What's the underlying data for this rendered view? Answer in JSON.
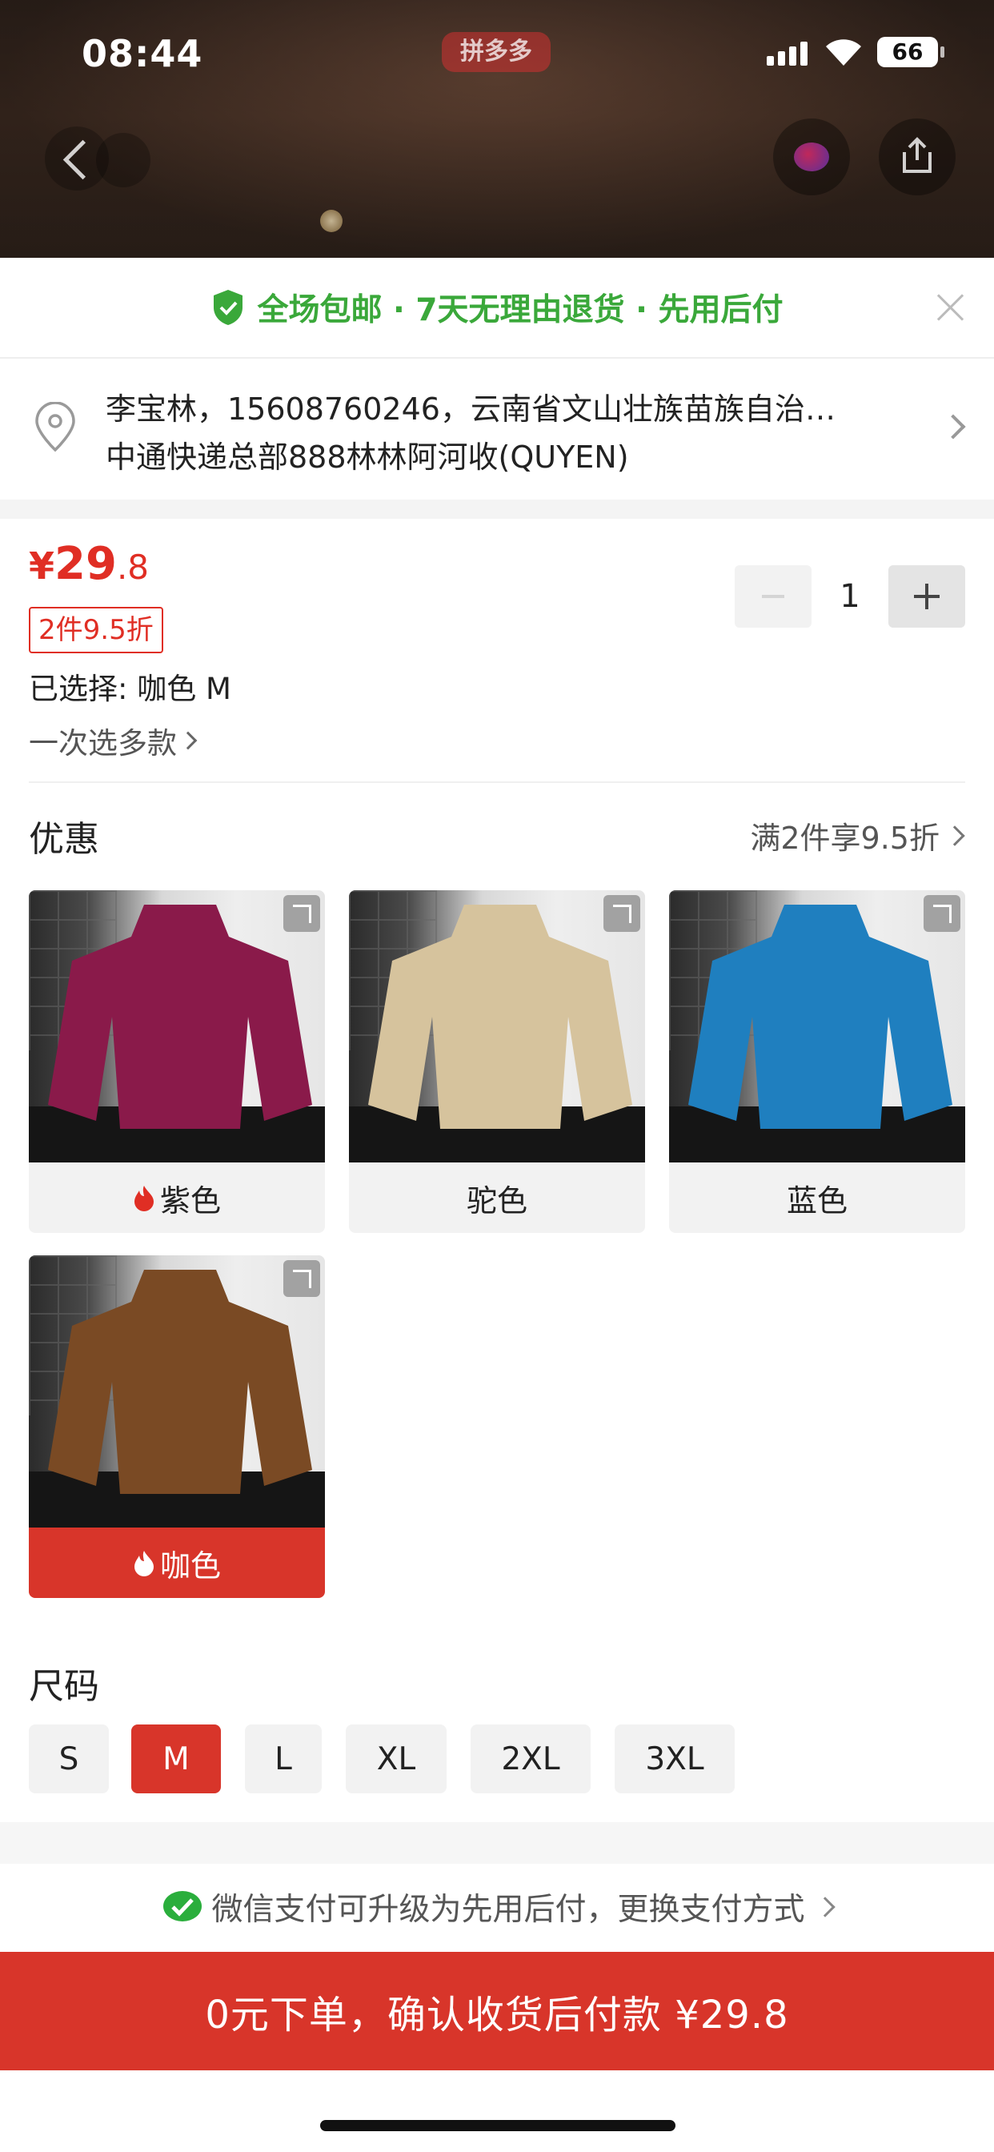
{
  "status_bar": {
    "time": "08:44",
    "battery": "66"
  },
  "hero": {
    "brand_chip": "拼多多"
  },
  "promo": {
    "text": "全场包邮 · 7天无理由退货 · 先用后付"
  },
  "address": {
    "line1": "李宝林，15608760246，云南省文山壮族苗族自治…",
    "line2": "中通快递总部888林林阿河收(QUYEN)"
  },
  "price": {
    "currency": "¥",
    "integer": "29",
    "decimal": ".8"
  },
  "discount_tag": "2件9.5折",
  "selected": "已选择: 咖色 M",
  "multi_select": "一次选多款",
  "quantity": "1",
  "offer": {
    "title": "优惠",
    "detail": "满2件享9.5折"
  },
  "colors": [
    {
      "label": "紫色",
      "hot": true,
      "swatch": "#8a1a4a"
    },
    {
      "label": "驼色",
      "hot": false,
      "swatch": "#d6c39d"
    },
    {
      "label": "蓝色",
      "hot": false,
      "swatch": "#1f7fbf"
    },
    {
      "label": "咖色",
      "hot": true,
      "swatch": "#7a4a24",
      "selected": true
    }
  ],
  "size": {
    "title": "尺码",
    "options": [
      "S",
      "M",
      "L",
      "XL",
      "2XL",
      "3XL"
    ],
    "selected": "M"
  },
  "pay_hint": "微信支付可升级为先用后付，更换支付方式",
  "submit_label": "0元下单，确认收货后付款 ¥29.8",
  "colors_theme": {
    "accent": "#d8352a",
    "price": "#e02e24",
    "promo_green": "#3aa83a",
    "wechat_green": "#2aae3c"
  }
}
